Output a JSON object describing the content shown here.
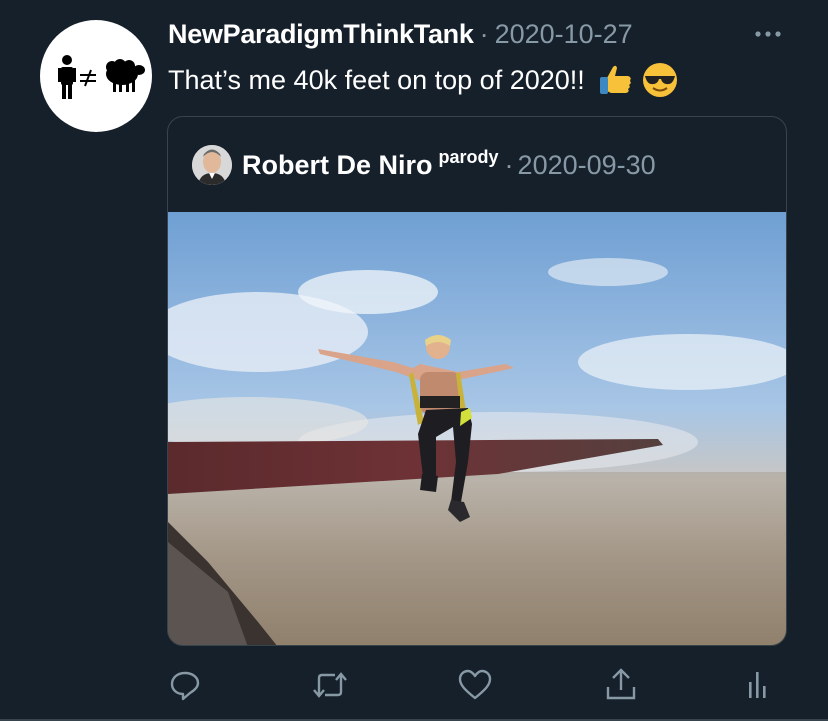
{
  "tweet": {
    "author_name": "NewParadigmThinkTank",
    "separator": "·",
    "date": "2020-10-27",
    "text": "That’s me 40k feet on top of 2020!!",
    "emojis": [
      "thumbs-up-emoji",
      "sunglasses-emoji"
    ],
    "avatar_icon": "person-not-equal-sheep-icon"
  },
  "quoted_tweet": {
    "author_name": "Robert De Niro",
    "tag": "parody",
    "separator": "·",
    "date": "2020-09-30",
    "media_description_icon": "video-thumbnail"
  },
  "actions": [
    {
      "name": "reply",
      "icon": "reply-icon"
    },
    {
      "name": "retweet",
      "icon": "retweet-icon"
    },
    {
      "name": "like",
      "icon": "heart-icon"
    },
    {
      "name": "share",
      "icon": "share-icon"
    },
    {
      "name": "analytics",
      "icon": "analytics-icon"
    }
  ],
  "colors": {
    "background": "#15202b",
    "secondary_text": "#8899a6",
    "border": "#38444d",
    "icon": "#8899a6"
  }
}
